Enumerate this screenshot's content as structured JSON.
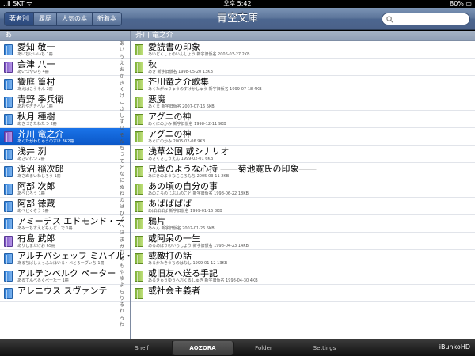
{
  "statusbar": {
    "carrier": "..ll SKT ᯤ",
    "time": "오후 5:42",
    "battery": "80% ▭"
  },
  "toolbar": {
    "segments": [
      {
        "label": "著者別",
        "active": true
      },
      {
        "label": "履歴",
        "active": false
      },
      {
        "label": "人気の本",
        "active": false
      },
      {
        "label": "新着本",
        "active": false
      }
    ],
    "title": "青空文庫",
    "search_placeholder": ""
  },
  "left_panel": {
    "header": "あ",
    "rows": [
      {
        "name": "愛知 敬一",
        "sub": "あいちけいいち 1冊",
        "color": "blue",
        "selected": false
      },
      {
        "name": "会津 八一",
        "sub": "あいづやいち 4冊",
        "color": "purple",
        "selected": false
      },
      {
        "name": "饗庭 篁村",
        "sub": "あえばこうそん 2冊",
        "color": "blue",
        "selected": false
      },
      {
        "name": "青野 季兵衛",
        "sub": "あおやぎきへい 1冊",
        "color": "blue",
        "selected": false
      },
      {
        "name": "秋月 種樹",
        "sub": "あきづきたねたつ 2冊",
        "color": "blue",
        "selected": false
      },
      {
        "name": "芥川 竜之介",
        "sub": "あくたがわりゅうのすけ 362冊",
        "color": "purple",
        "selected": true
      },
      {
        "name": "浅井 洌",
        "sub": "あさいれつ 2冊",
        "color": "blue",
        "selected": false
      },
      {
        "name": "浅沼 稲次郎",
        "sub": "あさぬまいねじろう 1冊",
        "color": "blue",
        "selected": false
      },
      {
        "name": "阿部 次郎",
        "sub": "あべじろう 1冊",
        "color": "blue",
        "selected": false
      },
      {
        "name": "阿部 徳蔵",
        "sub": "あべとくぞう 1冊",
        "color": "blue",
        "selected": false
      },
      {
        "name": "アミーチス エドモンド・デ",
        "sub": "あみーちすえどもんど・で 1冊",
        "color": "blue",
        "selected": false
      },
      {
        "name": "有島 武郎",
        "sub": "ありしまたけお 65冊",
        "color": "purple",
        "selected": false
      },
      {
        "name": "アルチバシェッフ ミハイル・ペトローヴィチ",
        "sub": "あるちばしぇっふみはいる・ぺとろーヴぃち 1冊",
        "color": "blue",
        "selected": false
      },
      {
        "name": "アルテンベルク ペーター",
        "sub": "あるてんべるくぺーたー 1冊",
        "color": "blue",
        "selected": false
      },
      {
        "name": "アレニウス スヴァンテ",
        "sub": "",
        "color": "blue",
        "selected": false
      }
    ],
    "index": [
      "あ",
      "い",
      "う",
      "え",
      "お",
      "か",
      "き",
      "く",
      "け",
      "こ",
      "さ",
      "し",
      "す",
      "せ",
      "そ",
      "た",
      "ち",
      "つ",
      "て",
      "と",
      "な",
      "に",
      "ぬ",
      "ね",
      "の",
      "は",
      "ひ",
      "ふ",
      "へ",
      "ほ",
      "ま",
      "み",
      "む",
      "め",
      "も",
      "や",
      "ゆ",
      "よ",
      "ら",
      "り",
      "る",
      "れ",
      "ろ",
      "わ"
    ]
  },
  "right_panel": {
    "header": "芥川 竜之介",
    "rows": [
      {
        "title": "愛読書の印象",
        "sub": "あいどくしょのいんしょう 新字旧仮名 2006-03-27 2KB"
      },
      {
        "title": "秋",
        "sub": "あき 新字旧仮名 1998-05-20 13KB"
      },
      {
        "title": "芥川竜之介歌集",
        "sub": "あくたがわりゅうのすけかしゅう 新字旧仮名 1999-07-18 4KB"
      },
      {
        "title": "悪魔",
        "sub": "あくま 新字旧仮名 2007-07-16 5KB"
      },
      {
        "title": "アグニの神",
        "sub": "あぐにのかみ 新字旧仮名 1998-12-11 9KB"
      },
      {
        "title": "アグニの神",
        "sub": "あぐにのかみ 2005-02-06 9KB"
      },
      {
        "title": "浅草公園 或シナリオ",
        "sub": "あさくさこうえん 1999-02-01 6KB"
      },
      {
        "title": "兄貴のような心持 ――菊池寛氏の印象――",
        "sub": "あにきのようなこころもち 2005-03-11 2KB"
      },
      {
        "title": "あの頃の自分の事",
        "sub": "あのころのじぶんのこと 新字旧仮名 1998-06-22 18KB"
      },
      {
        "title": "あばばばば",
        "sub": "あばばばば 新字旧仮名 1999-01-16 8KB"
      },
      {
        "title": "鴉片",
        "sub": "あへん 新字旧仮名 2002-01-26 5KB"
      },
      {
        "title": "或阿呆の一生",
        "sub": "あるあほうのいっしょう 新字旧仮名 1998-04-23 14KB"
      },
      {
        "title": "或敵打の話",
        "sub": "あるかたきうちのはなし 1999-01-12 13KB"
      },
      {
        "title": "或旧友へ送る手記",
        "sub": "あるきゅうゆうへおくるしゅき 新字旧仮名 1998-04-30 4KB"
      },
      {
        "title": "或社会主義者",
        "sub": ""
      }
    ]
  },
  "tabbar": {
    "tabs": [
      {
        "label": "Shelf",
        "active": false
      },
      {
        "label": "AOZORA",
        "active": true
      },
      {
        "label": "Folder",
        "active": false
      },
      {
        "label": "Settings",
        "active": false
      }
    ],
    "brand": "iBunkoHD"
  }
}
